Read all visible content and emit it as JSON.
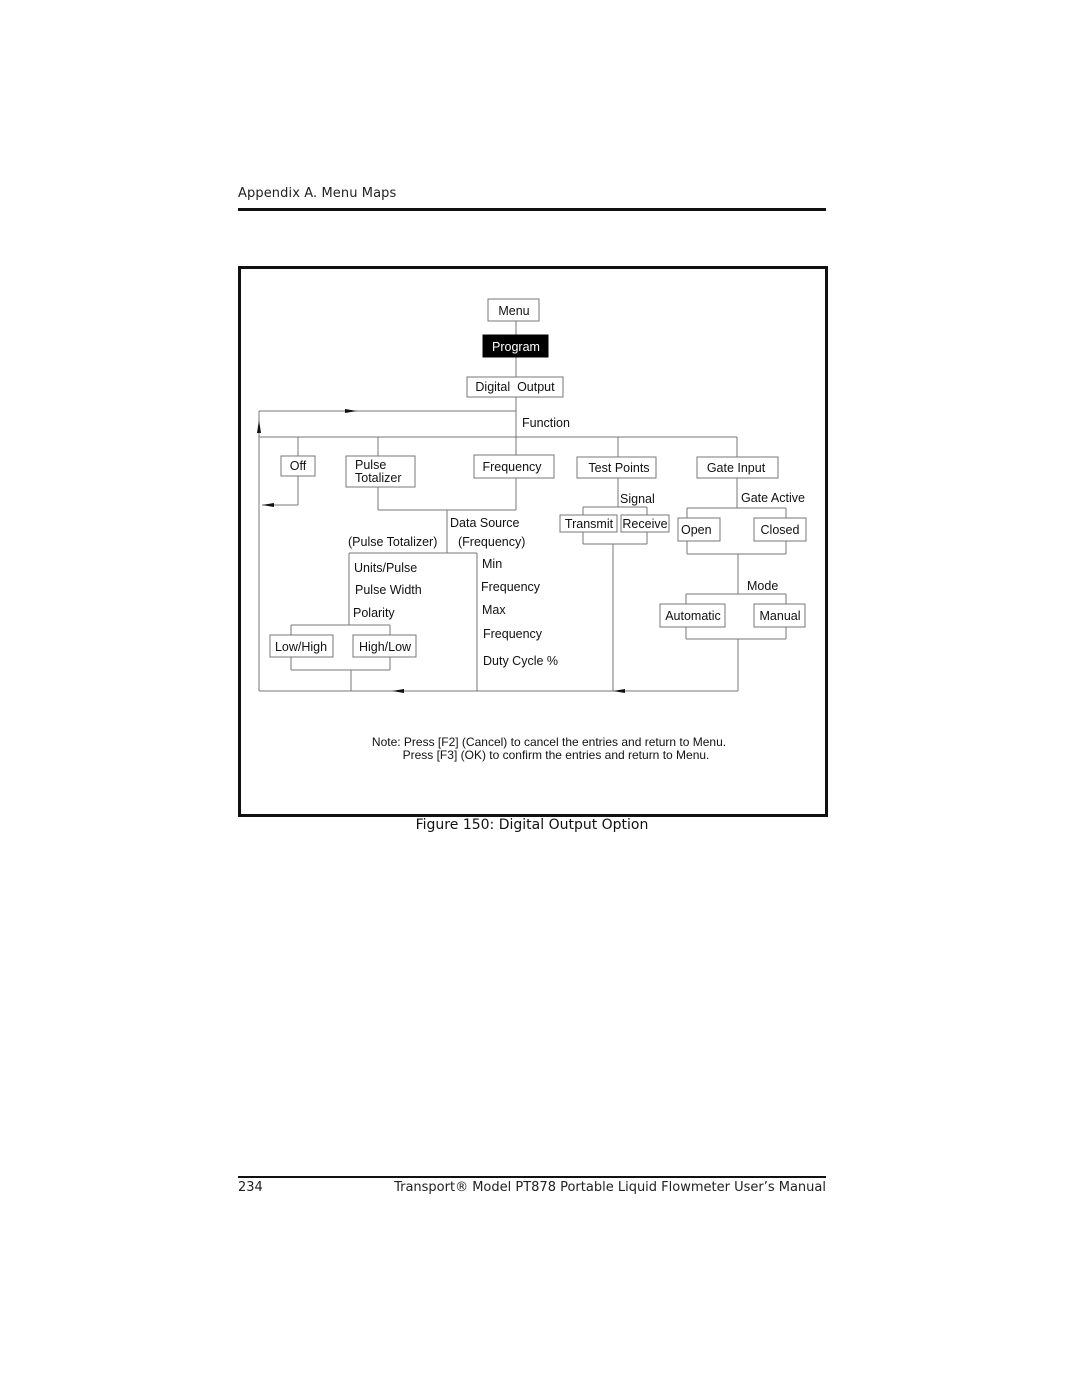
{
  "header": {
    "section_title": "Appendix A. Menu Maps"
  },
  "diagram": {
    "nodes": {
      "menu": "Menu",
      "program": "Program",
      "digital_output": "Digital  Output",
      "off": "Off",
      "pulse_totalizer_line1": "Pulse",
      "pulse_totalizer_line2": "Totalizer",
      "frequency": "Frequency",
      "test_points": "Test Points",
      "gate_input": "Gate Input",
      "transmit": "Transmit",
      "receive": "Receive",
      "open": "Open",
      "closed": "Closed",
      "automatic": "Automatic",
      "manual": "Manual",
      "low_high": "Low/High",
      "high_low": "High/Low"
    },
    "labels": {
      "function": "Function",
      "signal": "Signal",
      "gate_active": "Gate Active",
      "data_source": "Data Source",
      "pulse_totalizer_paren": "(Pulse Totalizer)",
      "frequency_paren": "(Frequency)",
      "units_pulse": "Units/Pulse",
      "pulse_width": "Pulse Width",
      "polarity": "Polarity",
      "min": "Min",
      "min_frequency": "Frequency",
      "max": "Max",
      "max_frequency": "Frequency",
      "duty_cycle": "Duty Cycle %",
      "mode": "Mode"
    },
    "note_line1": "Note: Press [F2] (Cancel) to cancel the entries and return to Menu.",
    "note_line2": "Press [F3] (OK) to confirm the entries and return to Menu."
  },
  "figure": {
    "caption": "Figure 150: Digital Output Option"
  },
  "footer": {
    "page_number": "234",
    "manual_title": "Transport® Model PT878 Portable Liquid Flowmeter User’s Manual"
  }
}
